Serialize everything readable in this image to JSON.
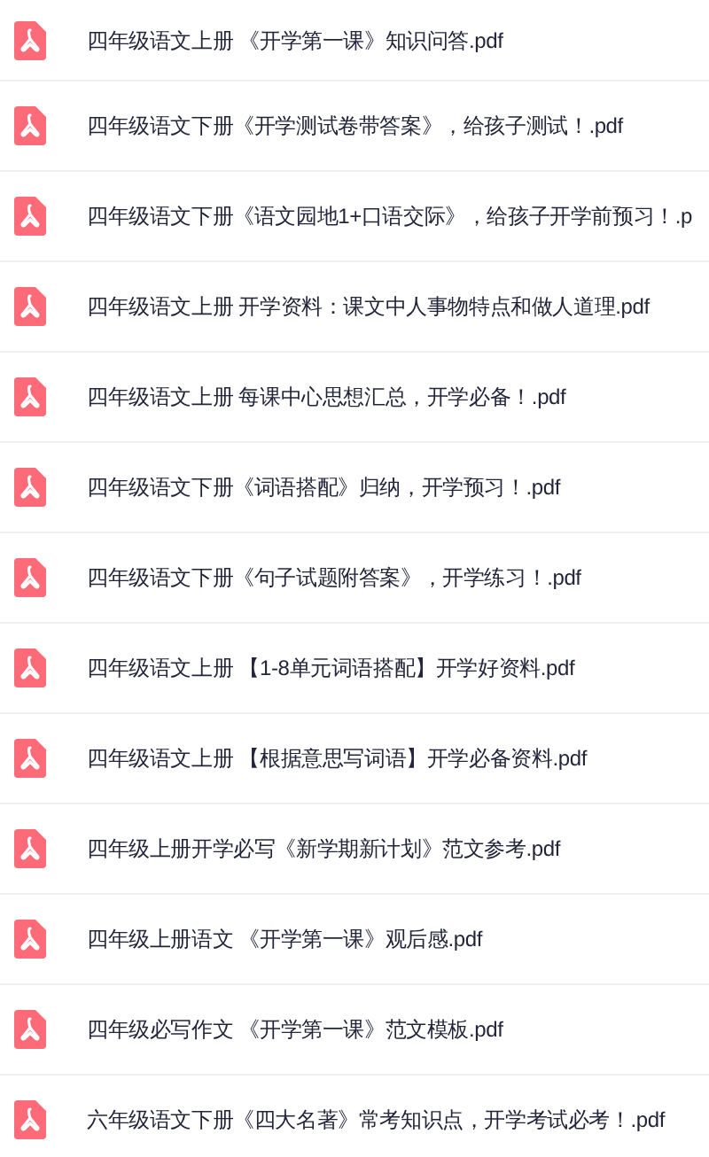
{
  "files": [
    {
      "name": "四年级语文上册 《开学第一课》知识问答.pdf"
    },
    {
      "name": "四年级语文下册《开学测试卷带答案》，给孩子测试！.pdf"
    },
    {
      "name": "四年级语文下册《语文园地1+口语交际》，给孩子开学前预习！.p"
    },
    {
      "name": "四年级语文上册 开学资料：课文中人事物特点和做人道理.pdf"
    },
    {
      "name": "四年级语文上册 每课中心思想汇总，开学必备！.pdf"
    },
    {
      "name": "四年级语文下册《词语搭配》归纳，开学预习！.pdf"
    },
    {
      "name": "四年级语文下册《句子试题附答案》，开学练习！.pdf"
    },
    {
      "name": "四年级语文上册 【1-8单元词语搭配】开学好资料.pdf"
    },
    {
      "name": "四年级语文上册 【根据意思写词语】开学必备资料.pdf"
    },
    {
      "name": "四年级上册开学必写《新学期新计划》范文参考.pdf"
    },
    {
      "name": "四年级上册语文 《开学第一课》观后感.pdf"
    },
    {
      "name": "四年级必写作文 《开学第一课》范文模板.pdf"
    },
    {
      "name": "六年级语文下册《四大名著》常考知识点，开学考试必考！.pdf"
    }
  ]
}
